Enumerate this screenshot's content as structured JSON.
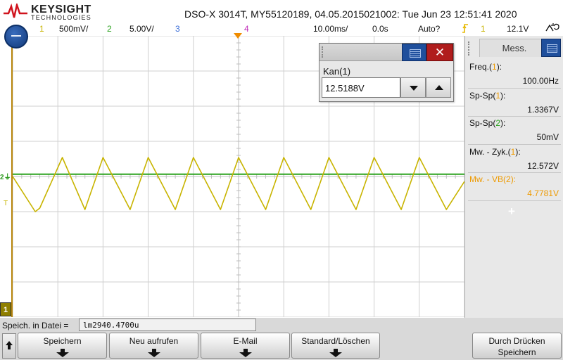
{
  "brand": {
    "name": "KEYSIGHT",
    "sub": "TECHNOLOGIES"
  },
  "title": "DSO-X 3014T, MY55120189, 04.05.2015021002: Tue Jun 23 12:51:41 2020",
  "status": {
    "ch1": {
      "num": "1",
      "scale": "500mV/",
      "color": "#c8b400"
    },
    "ch2": {
      "num": "2",
      "scale": "5.00V/",
      "color": "#2ba21e"
    },
    "ch3": {
      "num": "3",
      "color": "#3a6dd8"
    },
    "ch4": {
      "num": "4",
      "color": "#c02bb8"
    },
    "timebase": "10.00ms/",
    "delay": "0.0s",
    "trigger_mode": "Auto?",
    "trig_icon": "trigger-icon",
    "trig_channel": "1",
    "trig_level": "12.1V",
    "acquire_icon": "acquisition-mode-icon"
  },
  "screen": {
    "gnd_marker": "2",
    "trig_marker": "T",
    "ch1_marker": "1"
  },
  "dialog": {
    "label": "Kan(1)",
    "value": "12.5188V",
    "close_glyph": "✕"
  },
  "panel": {
    "tab": "Mess.",
    "measurements": [
      {
        "label": "Freq.(",
        "ch": "1",
        "suffix": "):",
        "value": "100.00Hz",
        "highlight": false
      },
      {
        "label": "Sp-Sp(",
        "ch": "1",
        "suffix": "):",
        "value": "1.3367V",
        "highlight": false
      },
      {
        "label": "Sp-Sp(",
        "ch": "2",
        "suffix": "):",
        "value": "50mV",
        "highlight": false
      },
      {
        "label": "Mw. - Zyk.(",
        "ch": "1",
        "suffix": "):",
        "value": "12.572V",
        "highlight": false
      },
      {
        "label": "Mw. - VB(",
        "ch": "2",
        "suffix": "):",
        "value": "4.7781V",
        "highlight": true
      }
    ],
    "add_glyph": "+"
  },
  "bottom": {
    "save_label": "Speich. in Datei =",
    "filename": "lm2940.4700u",
    "softkeys": [
      "Speichern",
      "Neu aufrufen",
      "E-Mail",
      "Standard/Löschen"
    ],
    "print": {
      "line1": "Durch Drücken",
      "line2": "Speichern"
    }
  },
  "colors": {
    "ch1": "#c8b400",
    "ch2": "#2ba21e",
    "highlight": "#ee9a00"
  },
  "chart_data": {
    "type": "line",
    "title": "",
    "xlabel": "",
    "ylabel": "",
    "x_unit": "ms",
    "xlim": [
      -50,
      50
    ],
    "series": [
      {
        "name": "",
        "color": "#c8b400",
        "x": [
          -50,
          -45,
          -44,
          -39,
          -34,
          -30,
          -24,
          -20,
          -14,
          -10,
          -4,
          0,
          6,
          10,
          16,
          20,
          26,
          30,
          36,
          40,
          46,
          50
        ],
        "y": [
          12.65,
          12.15,
          12.2,
          12.92,
          12.18,
          12.92,
          12.18,
          12.92,
          12.18,
          12.92,
          12.18,
          12.92,
          12.18,
          12.92,
          12.18,
          12.92,
          12.18,
          12.92,
          12.18,
          12.92,
          12.18,
          12.58
        ]
      },
      {
        "name": "",
        "color": "#2ba21e",
        "x": [
          -50,
          50
        ],
        "y": [
          4.78,
          4.78
        ]
      }
    ]
  }
}
